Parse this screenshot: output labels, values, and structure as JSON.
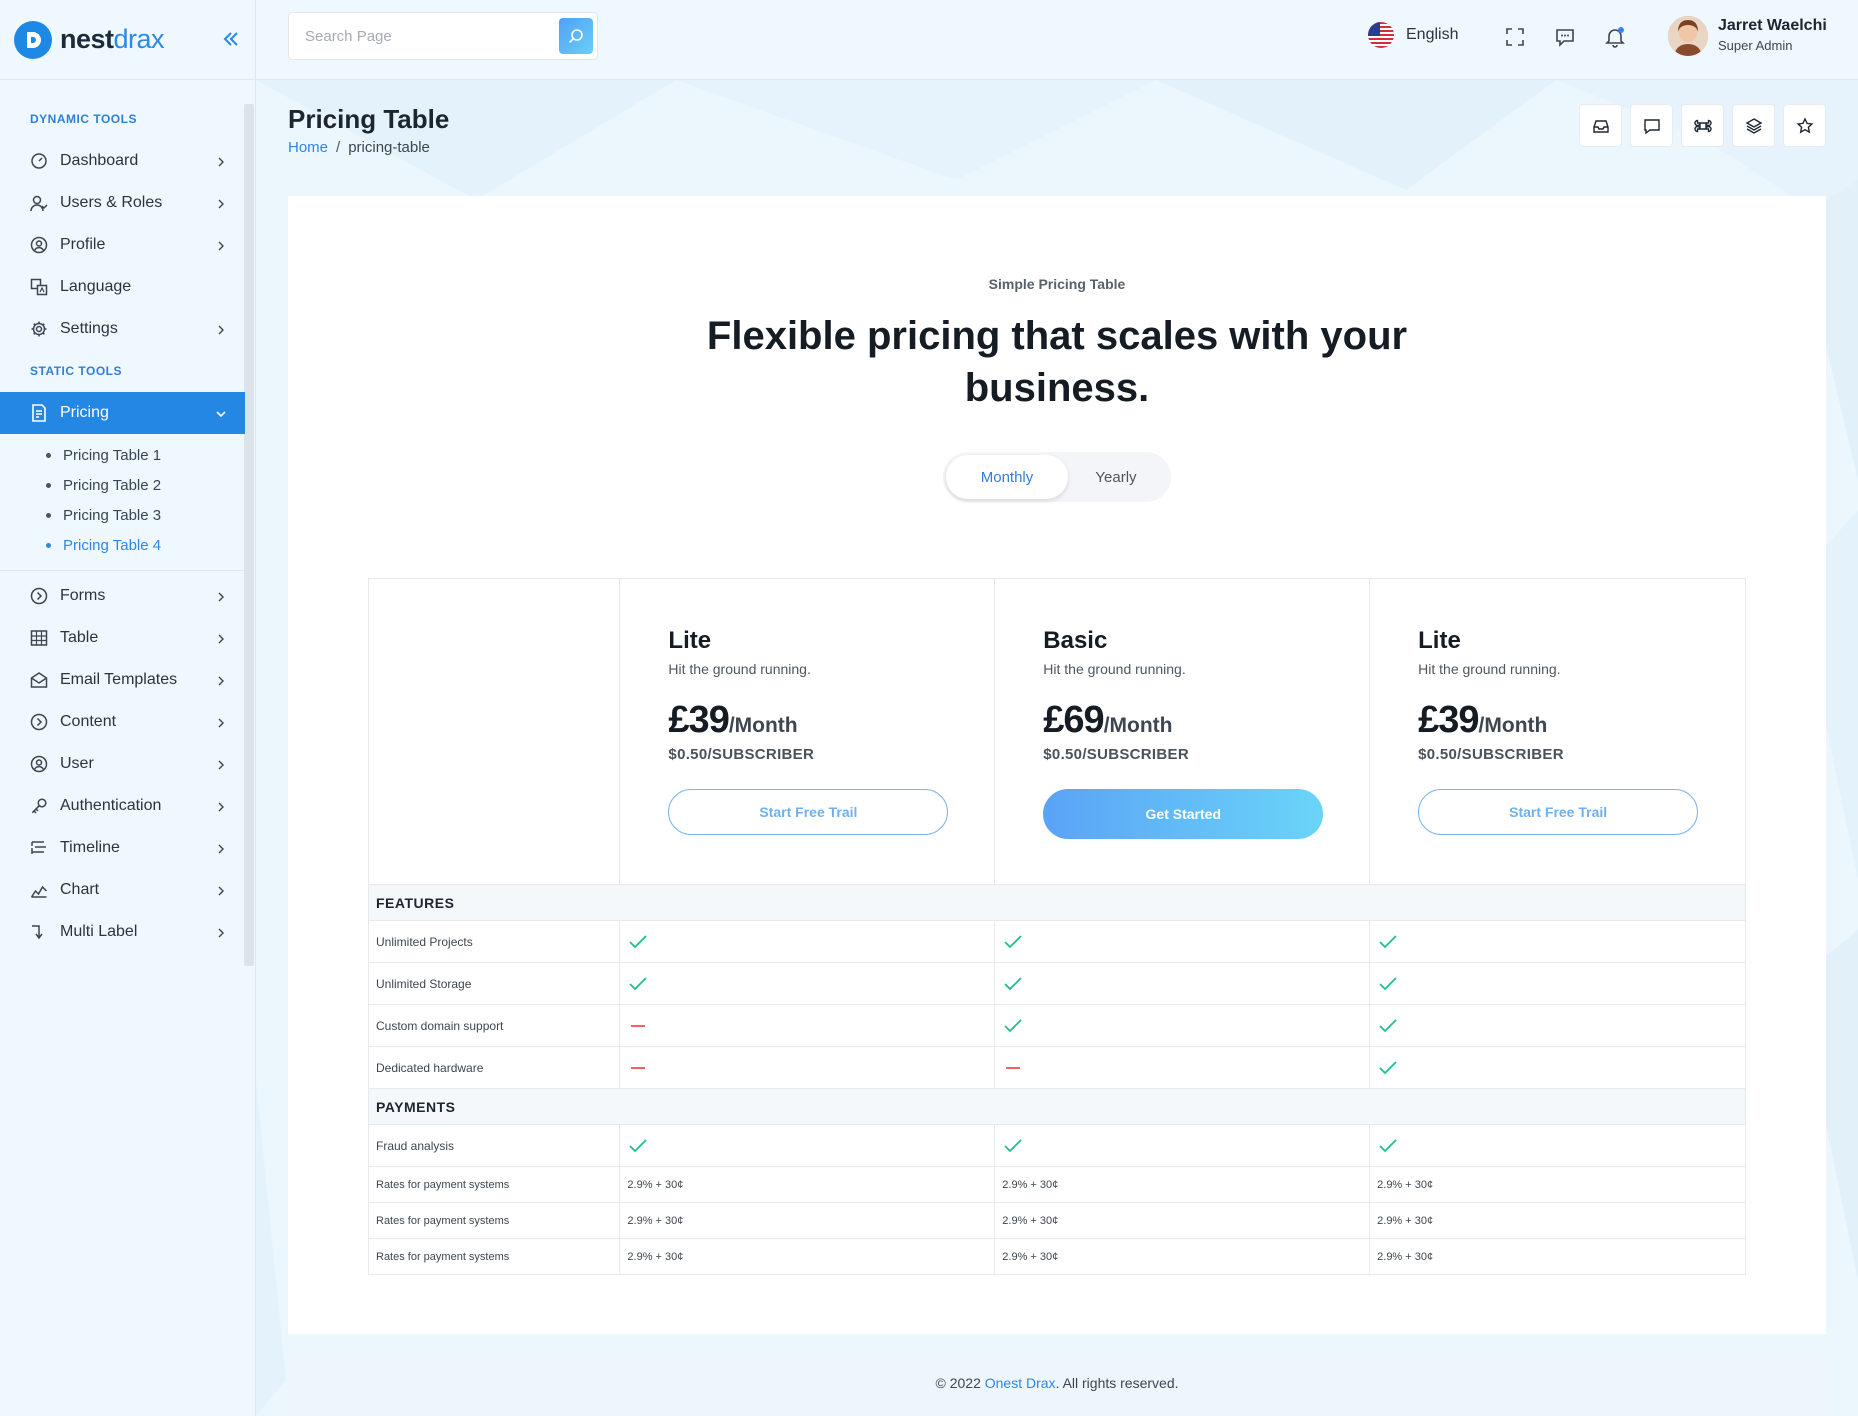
{
  "brand": {
    "part1": "nest",
    "part2": "drax"
  },
  "sidebar": {
    "dynamic_title": "DYNAMIC TOOLS",
    "dynamic_items": [
      {
        "label": "Dashboard",
        "icon": "gauge-icon"
      },
      {
        "label": "Users & Roles",
        "icon": "users-icon"
      },
      {
        "label": "Profile",
        "icon": "user-circle-icon"
      },
      {
        "label": "Language",
        "icon": "translate-icon"
      },
      {
        "label": "Settings",
        "icon": "gear-icon"
      }
    ],
    "static_title": "STATIC TOOLS",
    "active_item": {
      "label": "Pricing",
      "icon": "receipt-icon"
    },
    "sub_items": [
      {
        "label": "Pricing Table 1"
      },
      {
        "label": "Pricing Table 2"
      },
      {
        "label": "Pricing Table 3"
      },
      {
        "label": "Pricing Table 4"
      }
    ],
    "static_items": [
      {
        "label": "Forms",
        "icon": "chevron-circle-icon"
      },
      {
        "label": "Table",
        "icon": "grid-icon"
      },
      {
        "label": "Email Templates",
        "icon": "mail-open-icon"
      },
      {
        "label": "Content",
        "icon": "chevron-circle-icon"
      },
      {
        "label": "User",
        "icon": "user-circle-icon"
      },
      {
        "label": "Authentication",
        "icon": "key-icon"
      },
      {
        "label": "Timeline",
        "icon": "timeline-icon"
      },
      {
        "label": "Chart",
        "icon": "chart-line-icon"
      },
      {
        "label": "Multi Label",
        "icon": "arrow-down-right-icon"
      }
    ]
  },
  "topbar": {
    "search_placeholder": "Search Page",
    "language": "English",
    "user_name": "Jarret Waelchi",
    "user_role": "Super Admin"
  },
  "page": {
    "title": "Pricing Table",
    "breadcrumb_home": "Home",
    "breadcrumb_sep": "/",
    "breadcrumb_current": "pricing-table"
  },
  "pricing": {
    "eyebrow": "Simple Pricing Table",
    "headline": "Flexible pricing that scales with your business.",
    "toggle": {
      "monthly": "Monthly",
      "yearly": "Yearly"
    },
    "plans": [
      {
        "name": "Lite",
        "tagline": "Hit the ground running.",
        "price": "£39",
        "period": "/Month",
        "sub": "$0.50/SUBSCRIBER",
        "cta": "Start Free Trail"
      },
      {
        "name": "Basic",
        "tagline": "Hit the ground running.",
        "price": "£69",
        "period": "/Month",
        "sub": "$0.50/SUBSCRIBER",
        "cta": "Get Started"
      },
      {
        "name": "Lite",
        "tagline": "Hit the ground running.",
        "price": "£39",
        "period": "/Month",
        "sub": "$0.50/SUBSCRIBER",
        "cta": "Start Free Trail"
      }
    ],
    "features_title": "FEATURES",
    "features": [
      {
        "label": "Unlimited Projects",
        "values": [
          "check",
          "check",
          "check"
        ]
      },
      {
        "label": "Unlimited Storage",
        "values": [
          "check",
          "check",
          "check"
        ]
      },
      {
        "label": "Custom domain support",
        "values": [
          "dash",
          "check",
          "check"
        ]
      },
      {
        "label": "Dedicated hardware",
        "values": [
          "dash",
          "dash",
          "check"
        ]
      }
    ],
    "payments_title": "PAYMENTS",
    "payments_check": {
      "label": "Fraud analysis",
      "values": [
        "check",
        "check",
        "check"
      ]
    },
    "rates": [
      {
        "label": "Rates for payment systems",
        "values": [
          "2.9% + 30¢",
          "2.9% + 30¢",
          "2.9% + 30¢"
        ]
      },
      {
        "label": "Rates for payment systems",
        "values": [
          "2.9% + 30¢",
          "2.9% + 30¢",
          "2.9% + 30¢"
        ]
      },
      {
        "label": "Rates for payment systems",
        "values": [
          "2.9% + 30¢",
          "2.9% + 30¢",
          "2.9% + 30¢"
        ]
      }
    ]
  },
  "footer": {
    "prefix": "© 2022 ",
    "brand": "Onest Drax",
    "suffix": ". All rights reserved."
  },
  "colors": {
    "accent": "#2587e4",
    "check": "#1fbf8f",
    "dash": "#f0524f"
  }
}
